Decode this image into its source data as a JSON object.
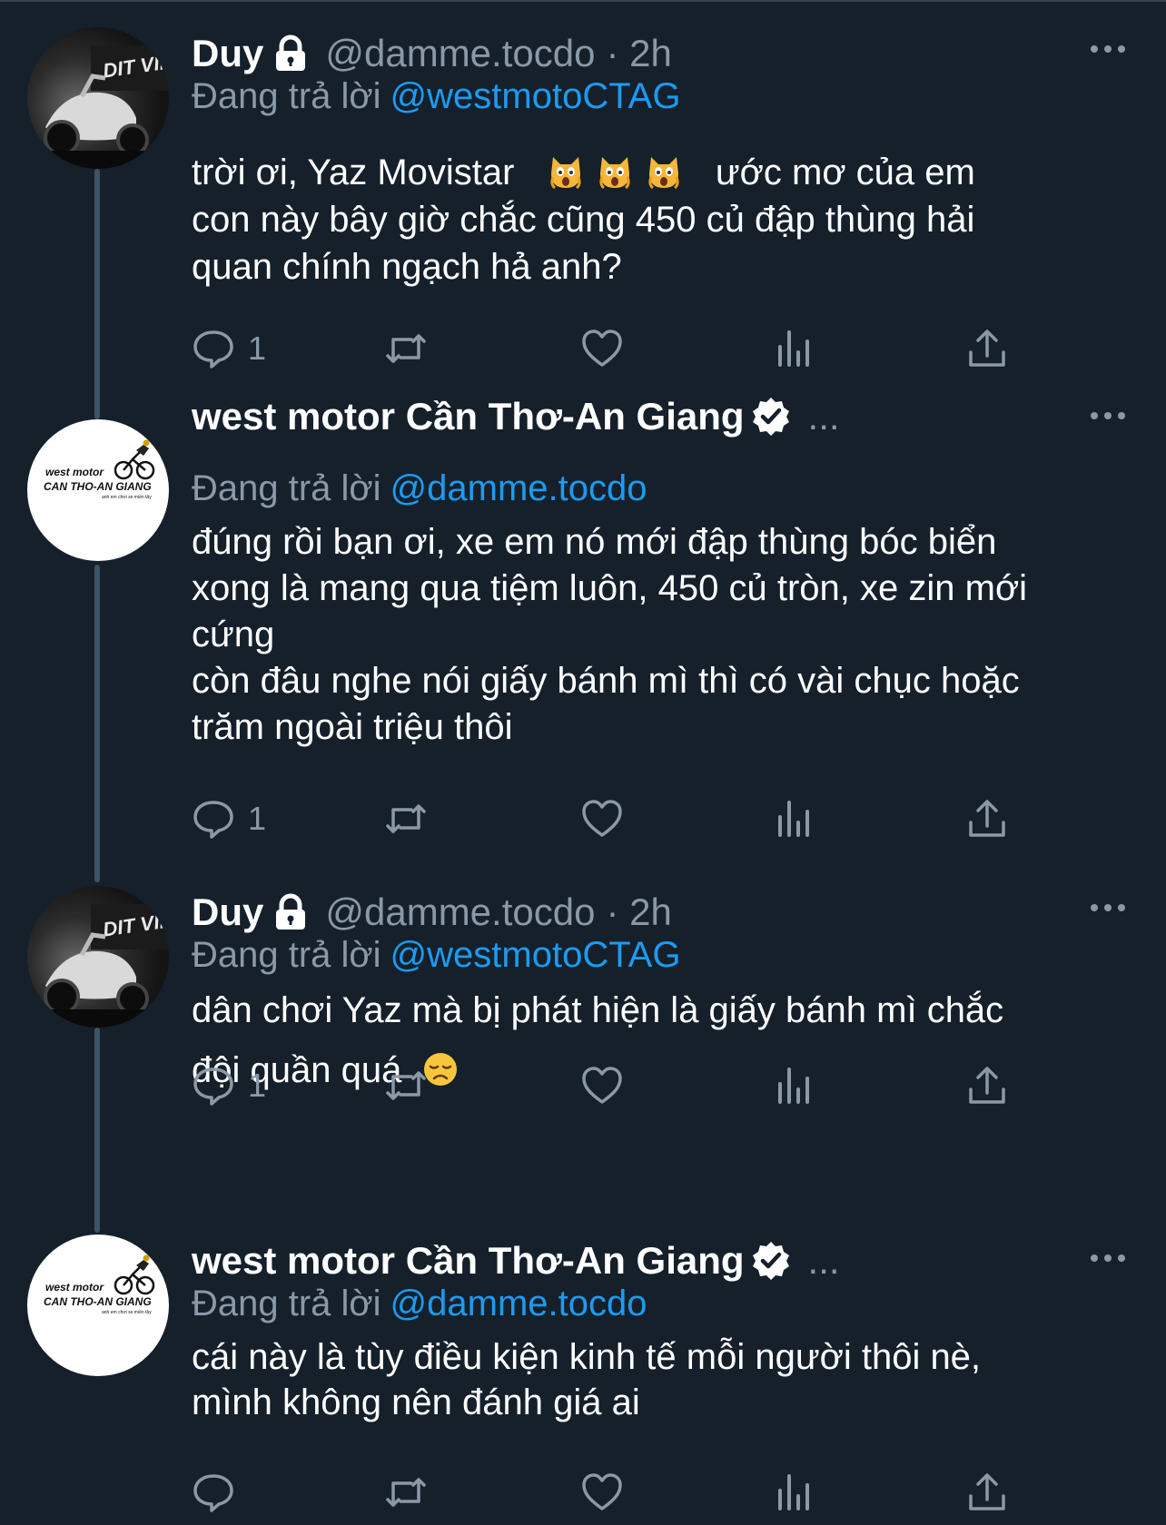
{
  "theme": {
    "background": "#15202b",
    "text": "#ffffff",
    "muted": "#8b98a5",
    "link": "#1d9bf0",
    "thread_line": "#3d5466"
  },
  "tweets": [
    {
      "author": "Duy",
      "handle": "@damme.tocdo",
      "time": "· 2h",
      "protected": true,
      "verified": false,
      "avatar": "motorcycle-photo",
      "reply_label": "Đang trả lời",
      "reply_to": "@westmotoCTAG",
      "lines": [
        "trời ơi, Yaz Movistar",
        "con này bây giờ chắc cũng 450 củ đập thùng hải",
        "quan chính ngạch hả anh?"
      ],
      "line1_suffix": "ước mơ của em",
      "emojis": [
        "scream-cat-icon",
        "scream-cat-icon",
        "scream-cat-icon"
      ],
      "reply_count": "1"
    },
    {
      "author": "west motor Cần Thơ-An Giang",
      "verified": true,
      "dots": "...",
      "avatar": "west-motor-logo",
      "reply_label": "Đang trả lời",
      "reply_to": "@damme.tocdo",
      "lines": [
        "đúng rồi bạn ơi, xe em nó mới đập thùng bóc biển",
        "xong là mang qua tiệm luôn, 450 củ tròn, xe zin mới",
        "cứng",
        "còn đâu nghe nói giấy bánh mì thì có vài chục hoặc",
        "trăm ngoài triệu thôi"
      ],
      "reply_count": "1"
    },
    {
      "author": "Duy",
      "handle": "@damme.tocdo",
      "time": "· 2h",
      "protected": true,
      "avatar": "motorcycle-photo",
      "reply_label": "Đang trả lời",
      "reply_to": "@westmotoCTAG",
      "lines": [
        "dân chơi Yaz mà bị phát hiện là giấy bánh mì chắc",
        "đội quần quá"
      ],
      "emojis": [
        "disappointed-face-icon"
      ],
      "reply_count": "1"
    },
    {
      "author": "west motor Cần Thơ-An Giang",
      "verified": true,
      "dots": "...",
      "avatar": "west-motor-logo",
      "reply_label": "Đang trả lời",
      "reply_to": "@damme.tocdo",
      "lines": [
        "cái này là tùy điều kiện kinh tế mỗi người thôi nè,",
        "mình không nên đánh giá ai"
      ],
      "reply_count": ""
    }
  ],
  "logo": {
    "line1": "west motor",
    "line2": "CAN THO-AN GIANG",
    "line3": "anh em chơi xe miền tây"
  },
  "avatar_photo_text": "DIT VIET TEAM",
  "action_icons": [
    "reply-icon",
    "retweet-icon",
    "like-icon",
    "analytics-icon",
    "share-icon"
  ]
}
